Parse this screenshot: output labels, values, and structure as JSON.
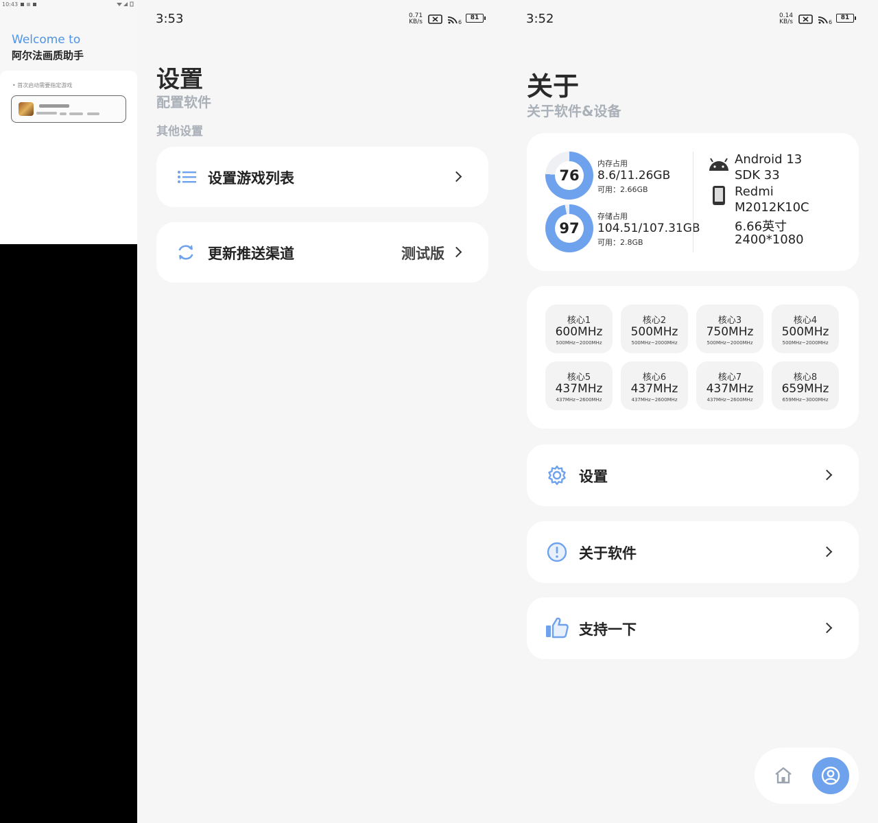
{
  "panel1": {
    "status_time": "10:43",
    "welcome": "Welcome to",
    "app_name": "阿尔法画质助手",
    "hint": "• 首次启动需要指定游戏"
  },
  "panel2": {
    "status_time": "3:53",
    "net_speed_value": "0.71",
    "net_speed_unit": "KB/s",
    "signal_label": "6",
    "battery": "81",
    "title": "设置",
    "subtitle": "配置软件",
    "section": "其他设置",
    "items": [
      {
        "label": "设置游戏列表",
        "icon": "list-icon",
        "value": ""
      },
      {
        "label": "更新推送渠道",
        "icon": "refresh-icon",
        "value": "测试版"
      }
    ]
  },
  "panel3": {
    "status_time": "3:52",
    "net_speed_value": "0.14",
    "net_speed_unit": "KB/s",
    "signal_label": "6",
    "battery": "81",
    "title": "关于",
    "subtitle": "关于软件&设备",
    "memory": {
      "percent": 76,
      "label": "内存占用",
      "value": "8.6/11.26GB",
      "available": "可用：2.66GB"
    },
    "storage": {
      "percent": 97,
      "label": "存储占用",
      "value": "104.51/107.31GB",
      "available": "可用：2.8GB"
    },
    "device": {
      "android": "Android 13",
      "sdk": "SDK 33",
      "brand": "Redmi",
      "model": "M2012K10C",
      "screen_size": "6.66英寸",
      "resolution": "2400*1080"
    },
    "cores": [
      {
        "name": "核心1",
        "freq": "600MHz",
        "range": "500MHz~2000MHz"
      },
      {
        "name": "核心2",
        "freq": "500MHz",
        "range": "500MHz~2000MHz"
      },
      {
        "name": "核心3",
        "freq": "750MHz",
        "range": "500MHz~2000MHz"
      },
      {
        "name": "核心4",
        "freq": "500MHz",
        "range": "500MHz~2000MHz"
      },
      {
        "name": "核心5",
        "freq": "437MHz",
        "range": "437MHz~2600MHz"
      },
      {
        "name": "核心6",
        "freq": "437MHz",
        "range": "437MHz~2600MHz"
      },
      {
        "name": "核心7",
        "freq": "437MHz",
        "range": "437MHz~2600MHz"
      },
      {
        "name": "核心8",
        "freq": "659MHz",
        "range": "659MHz~3000MHz"
      }
    ],
    "menu": [
      {
        "label": "设置",
        "icon": "gear-icon"
      },
      {
        "label": "关于软件",
        "icon": "info-icon"
      },
      {
        "label": "支持一下",
        "icon": "thumbs-up-icon"
      }
    ],
    "nav": [
      {
        "icon": "home-icon",
        "active": false
      },
      {
        "icon": "profile-icon",
        "active": true
      }
    ]
  },
  "colors": {
    "accent": "#6ea2ec",
    "ring_track": "#eef0f3",
    "title_gray": "#aab0b8"
  }
}
